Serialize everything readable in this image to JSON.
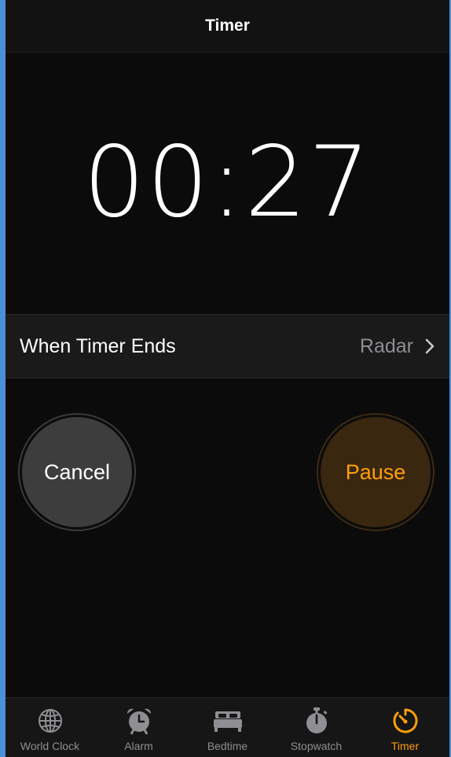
{
  "navbar": {
    "title": "Timer"
  },
  "timer": {
    "display": "00:27"
  },
  "when_timer_ends": {
    "label": "When Timer Ends",
    "value": "Radar"
  },
  "buttons": {
    "cancel": "Cancel",
    "pause": "Pause"
  },
  "tabs": [
    {
      "label": "World Clock",
      "icon": "globe-icon",
      "active": false
    },
    {
      "label": "Alarm",
      "icon": "alarm-clock-icon",
      "active": false
    },
    {
      "label": "Bedtime",
      "icon": "bed-icon",
      "active": false
    },
    {
      "label": "Stopwatch",
      "icon": "stopwatch-icon",
      "active": false
    },
    {
      "label": "Timer",
      "icon": "timer-icon",
      "active": true
    }
  ],
  "colors": {
    "accent": "#ff9f0a",
    "inactive_tab": "#8e8e93",
    "background": "#0b0b0b"
  }
}
